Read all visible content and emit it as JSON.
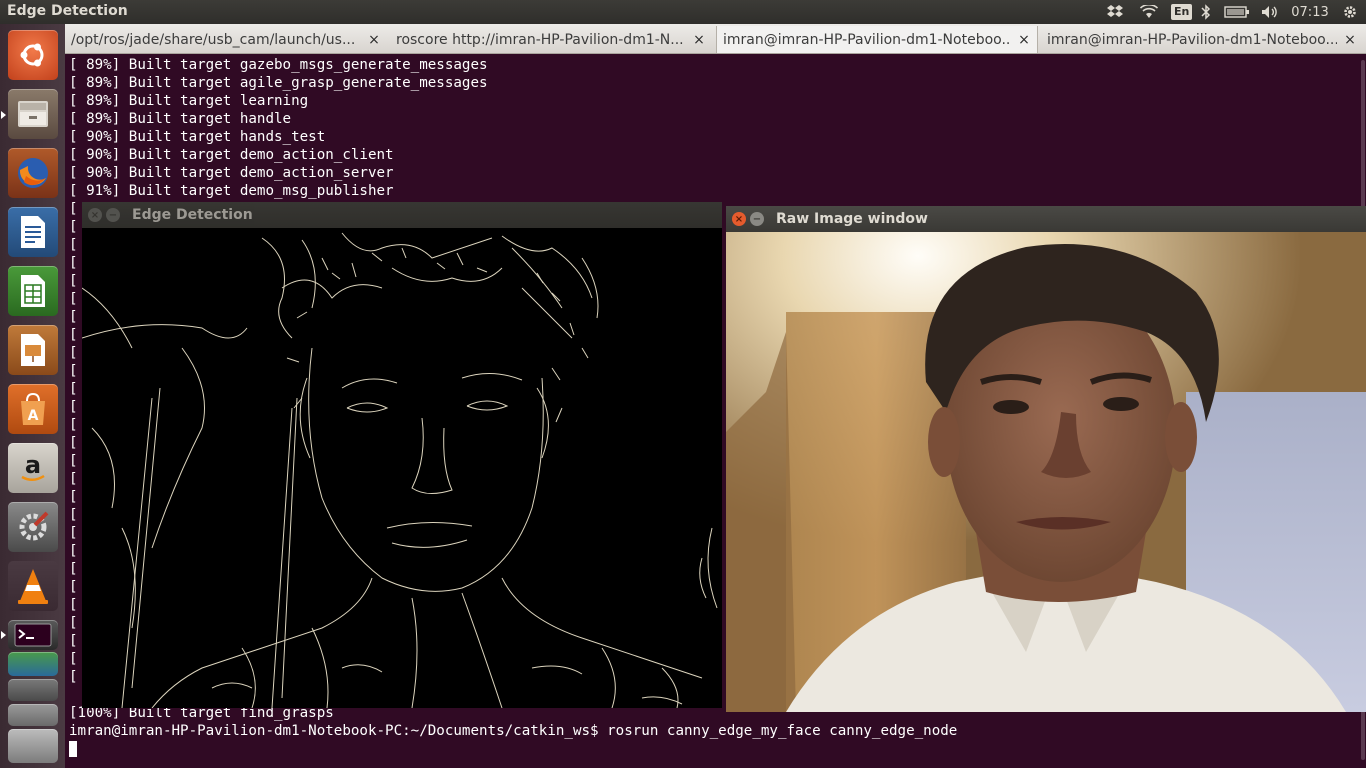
{
  "top_panel": {
    "title": "Edge Detection",
    "keyboard_layout": "En",
    "clock": "07:13"
  },
  "launcher": {
    "items": [
      "ubuntu-dash-icon",
      "files-icon",
      "firefox-icon",
      "writer-icon",
      "calc-icon",
      "impress-icon",
      "software-center-icon",
      "amazon-icon",
      "system-settings-icon",
      "vlc-icon",
      "terminal-icon",
      "workspace-switcher-icon"
    ]
  },
  "terminal": {
    "tabs": [
      {
        "label": "/opt/ros/jade/share/usb_cam/launch/us...",
        "active": false
      },
      {
        "label": "roscore http://imran-HP-Pavilion-dm1-N...",
        "active": false
      },
      {
        "label": "imran@imran-HP-Pavilion-dm1-Noteboo...",
        "active": true
      },
      {
        "label": "imran@imran-HP-Pavilion-dm1-Noteboo...",
        "active": false
      }
    ],
    "tab_close_glyph": "×",
    "lines": [
      "[ 89%] Built target gazebo_msgs_generate_messages",
      "[ 89%] Built target agile_grasp_generate_messages",
      "[ 89%] Built target learning",
      "[ 89%] Built target handle",
      "[ 90%] Built target hands_test",
      "[ 90%] Built target demo_action_client",
      "[ 90%] Built target demo_action_server",
      "[ 91%] Built target demo_msg_publisher"
    ],
    "last_build_line": "[100%] Built target find_grasps",
    "prompt": "imran@imran-HP-Pavilion-dm1-Notebook-PC:~/Documents/catkin_ws$ ",
    "command": "rosrun canny_edge_my_face canny_edge_node"
  },
  "edge_window": {
    "title": "Edge Detection",
    "close_glyph": "×",
    "minimize_glyph": "−"
  },
  "raw_window": {
    "title": "Raw Image window",
    "close_glyph": "×",
    "minimize_glyph": "−"
  },
  "colors": {
    "terminal_bg": "#300a24",
    "panel_bg": "#3c3b37",
    "close_button": "#e55b2d"
  }
}
